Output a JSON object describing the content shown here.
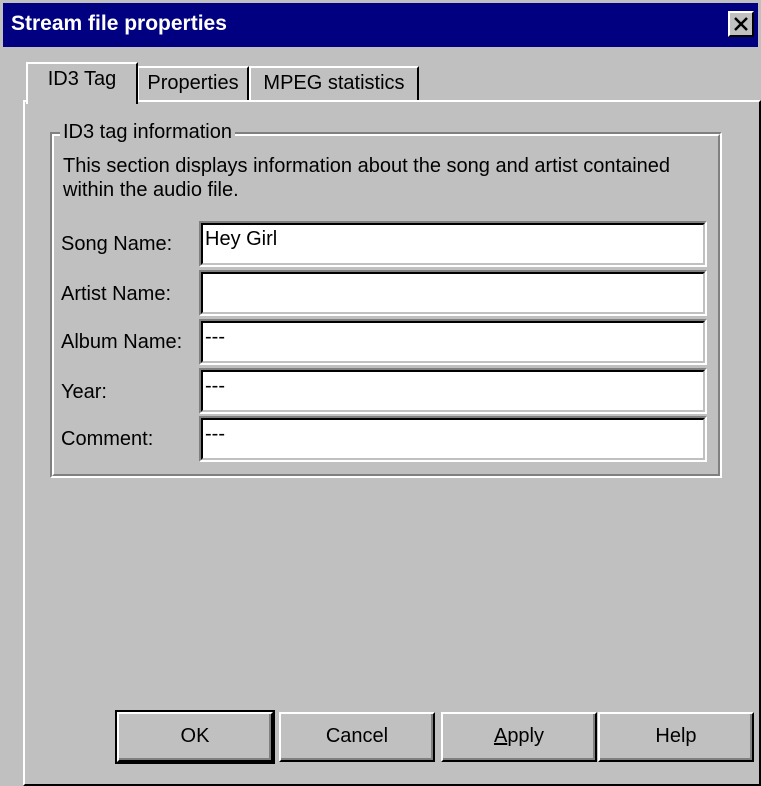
{
  "window": {
    "title": "Stream file properties",
    "close_label": "Close"
  },
  "tabs": [
    {
      "label": "ID3 Tag",
      "active": true
    },
    {
      "label": "Properties",
      "active": false
    },
    {
      "label": "MPEG statistics",
      "active": false
    }
  ],
  "group": {
    "legend": "ID3 tag information",
    "description": "This section displays information about the song and artist contained within the audio file."
  },
  "fields": [
    {
      "label": "Song Name:",
      "value": "Hey Girl"
    },
    {
      "label": "Artist Name:",
      "value": ""
    },
    {
      "label": "Album Name:",
      "value": "---"
    },
    {
      "label": "Year:",
      "value": "---"
    },
    {
      "label": "Comment:",
      "value": "---"
    }
  ],
  "buttons": {
    "ok": "OK",
    "cancel": "Cancel",
    "apply": "Apply",
    "help": "Help"
  },
  "colors": {
    "titlebar": "#000080",
    "face": "#c0c0c0"
  }
}
